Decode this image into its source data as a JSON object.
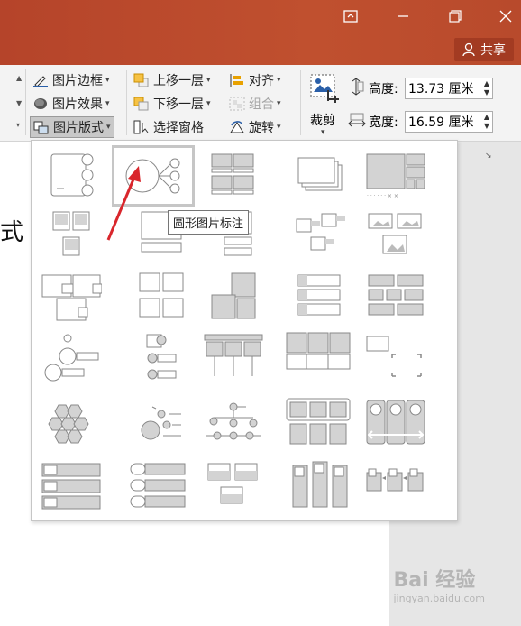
{
  "window": {
    "share_label": "共享"
  },
  "ribbon": {
    "picture_border": "图片边框",
    "picture_effects": "图片效果",
    "picture_layout": "图片版式",
    "bring_forward": "上移一层",
    "send_backward": "下移一层",
    "selection_pane": "选择窗格",
    "align": "对齐",
    "group": "组合",
    "rotate": "旋转",
    "crop": "裁剪",
    "height_label": "高度:",
    "height_value": "13.73 厘米",
    "width_label": "宽度:",
    "width_value": "16.59 厘米"
  },
  "document": {
    "partial_text": "式"
  },
  "gallery": {
    "tooltip": "圆形图片标注",
    "selected_item": "圆形图片标注",
    "items": [
      "layout-1",
      "layout-2",
      "layout-3",
      "layout-4",
      "layout-5",
      "layout-6",
      "layout-7",
      "layout-8",
      "layout-9",
      "layout-10",
      "layout-11",
      "layout-12",
      "layout-13",
      "layout-14",
      "layout-15",
      "layout-16",
      "layout-17",
      "layout-18",
      "layout-19",
      "layout-20",
      "layout-21",
      "layout-22",
      "layout-23",
      "layout-24",
      "layout-25",
      "layout-26",
      "layout-27",
      "layout-28",
      "layout-29",
      "layout-30"
    ]
  },
  "watermark": {
    "text": "Bai 经验",
    "sub": "jingyan.baidu.com"
  },
  "colors": {
    "title_bar": "#b7472a",
    "arrow": "#d9262c"
  }
}
